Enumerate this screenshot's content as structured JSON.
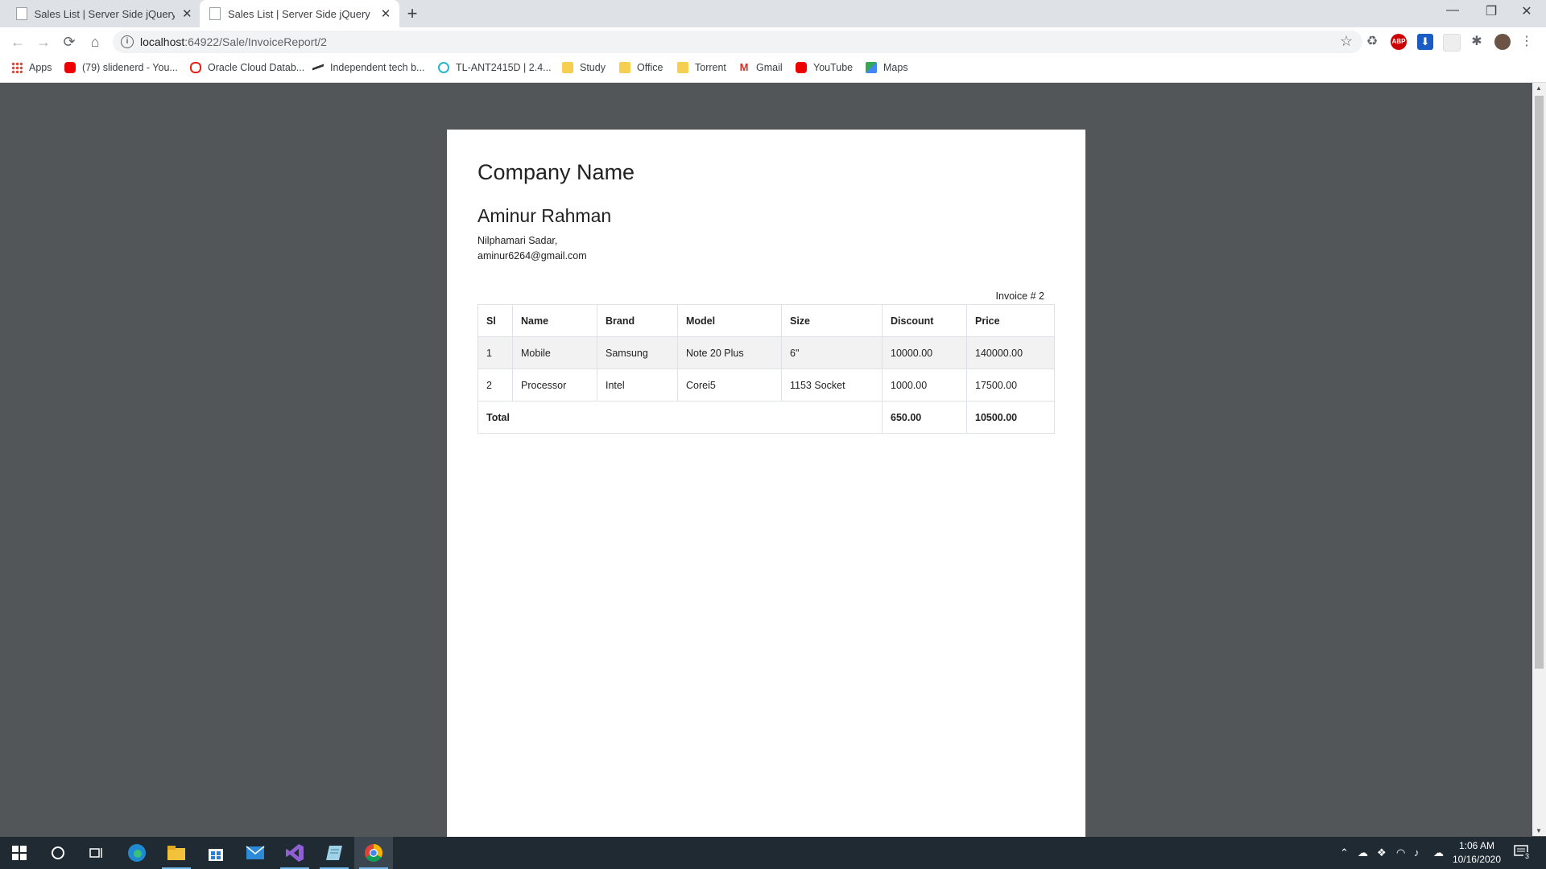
{
  "browser": {
    "tabs": [
      {
        "title": "Sales List | Server Side jQuery Da",
        "active": false
      },
      {
        "title": "Sales List | Server Side jQuery Da",
        "active": true
      }
    ],
    "new_tab_label": "+",
    "window_controls": {
      "minimize": "—",
      "restore": "❐",
      "close": "✕"
    },
    "url_host": "localhost",
    "url_path": ":64922/Sale/InvoiceReport/2",
    "info_icon": "i",
    "extensions": {
      "abp_label": "ABP"
    }
  },
  "bookmarks": [
    {
      "label": "Apps",
      "icon": "apps-grid-icon"
    },
    {
      "label": "(79) slidenerd - You...",
      "icon": "youtube-icon"
    },
    {
      "label": "Oracle Cloud Datab...",
      "icon": "oracle-icon"
    },
    {
      "label": "Independent tech b...",
      "icon": "site-icon"
    },
    {
      "label": "TL-ANT2415D | 2.4...",
      "icon": "tplink-icon"
    },
    {
      "label": "Study",
      "icon": "folder-icon"
    },
    {
      "label": "Office",
      "icon": "folder-icon"
    },
    {
      "label": "Torrent",
      "icon": "folder-icon"
    },
    {
      "label": "Gmail",
      "icon": "gmail-icon"
    },
    {
      "label": "YouTube",
      "icon": "youtube-icon"
    },
    {
      "label": "Maps",
      "icon": "maps-icon"
    }
  ],
  "invoice": {
    "company_name": "Company Name",
    "customer_name": "Aminur Rahman",
    "address_line": "Nilphamari Sadar,",
    "email": "aminur6264@gmail.com",
    "invoice_number": "Invoice # 2",
    "columns": [
      "Sl",
      "Name",
      "Brand",
      "Model",
      "Size",
      "Discount",
      "Price"
    ],
    "rows": [
      [
        "1",
        "Mobile",
        "Samsung",
        "Note 20 Plus",
        "6\"",
        "10000.00",
        "140000.00"
      ],
      [
        "2",
        "Processor",
        "Intel",
        "Corei5",
        "1153 Socket",
        "1000.00",
        "17500.00"
      ]
    ],
    "total_label": "Total",
    "total_discount": "650.00",
    "total_price": "10500.00"
  },
  "taskbar": {
    "time": "1:06 AM",
    "date": "10/16/2020",
    "notification_count": "3"
  }
}
